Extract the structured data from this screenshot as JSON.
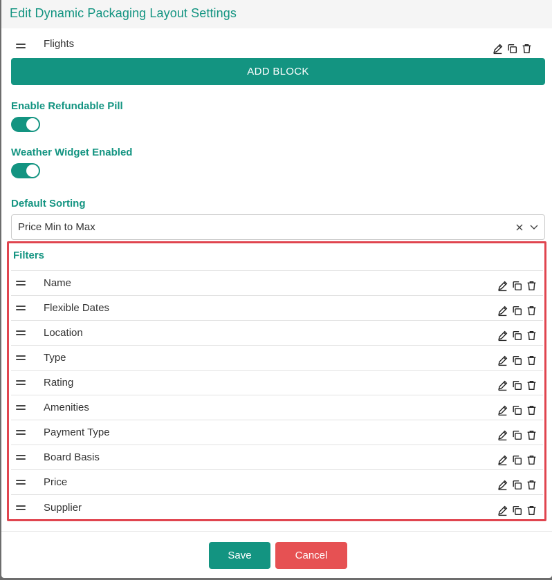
{
  "modal": {
    "title": "Edit Dynamic Packaging Layout Settings"
  },
  "blocks": [
    {
      "label": "Flights"
    }
  ],
  "add_block_label": "ADD BLOCK",
  "refundable": {
    "label": "Enable Refundable Pill",
    "enabled": true
  },
  "weather": {
    "label": "Weather Widget Enabled",
    "enabled": true
  },
  "sorting": {
    "label": "Default Sorting",
    "value": "Price Min to Max"
  },
  "filters": {
    "title": "Filters",
    "items": [
      {
        "label": "Name"
      },
      {
        "label": "Flexible Dates"
      },
      {
        "label": "Location"
      },
      {
        "label": "Type"
      },
      {
        "label": "Rating"
      },
      {
        "label": "Amenities"
      },
      {
        "label": "Payment Type"
      },
      {
        "label": "Board Basis"
      },
      {
        "label": "Price"
      },
      {
        "label": "Supplier"
      }
    ]
  },
  "footer": {
    "save_label": "Save",
    "cancel_label": "Cancel"
  },
  "colors": {
    "accent": "#139481",
    "danger": "#e65153",
    "highlight": "#e0454f"
  },
  "icons": {
    "drag": "drag-handle-icon",
    "edit": "pencil-icon",
    "copy": "copy-icon",
    "delete": "trash-icon"
  }
}
